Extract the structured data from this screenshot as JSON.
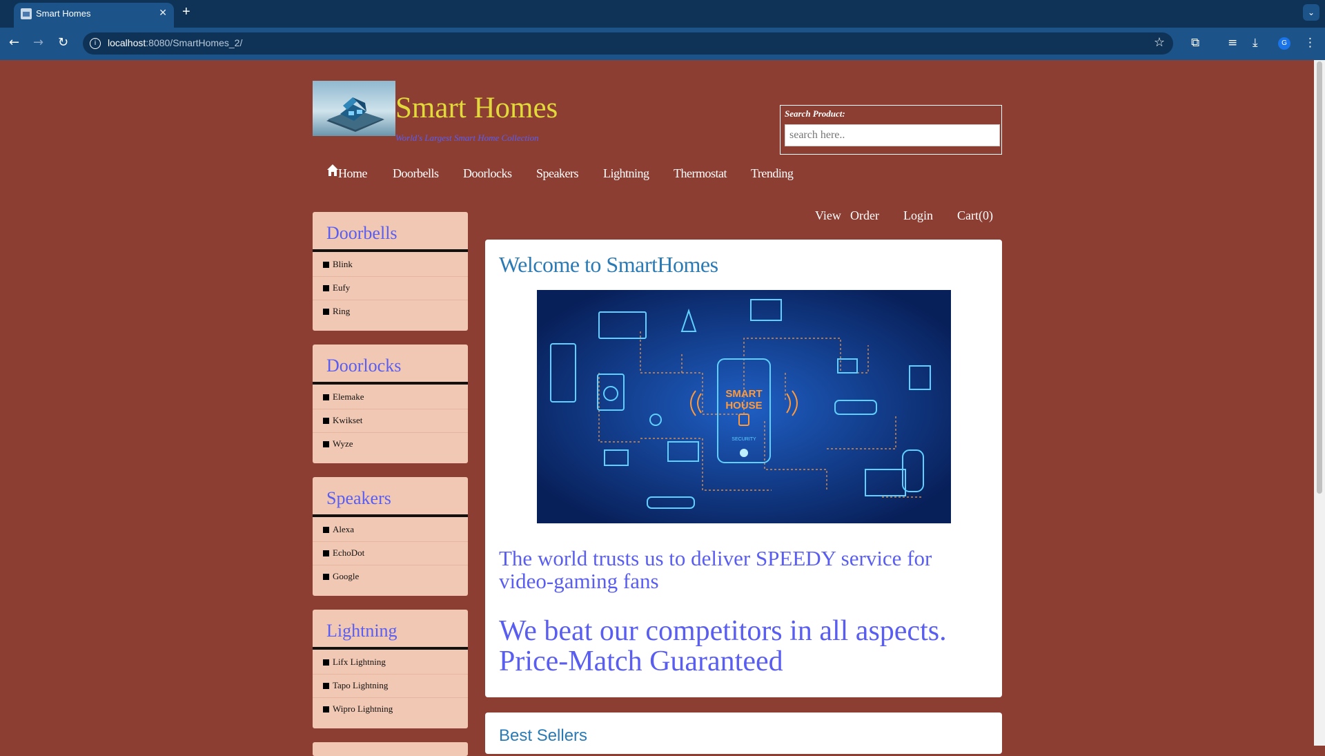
{
  "browser": {
    "tab_title": "Smart Homes",
    "url_host": "localhost",
    "url_rest": ":8080/SmartHomes_2/",
    "avatar_letter": "G"
  },
  "header": {
    "title": "Smart Homes",
    "tagline": "World's Largest Smart Home Collection",
    "search_label": "Search Product:",
    "search_placeholder": "search here.."
  },
  "nav": [
    "Home",
    "Doorbells",
    "Doorlocks",
    "Speakers",
    "Lightning",
    "Thermostat",
    "Trending"
  ],
  "user_nav": [
    "View",
    "Order",
    "Login",
    "Cart(0)"
  ],
  "sidebar": [
    {
      "title": "Doorbells",
      "items": [
        "Blink",
        "Eufy",
        "Ring"
      ]
    },
    {
      "title": "Doorlocks",
      "items": [
        "Elemake",
        "Kwikset",
        "Wyze"
      ]
    },
    {
      "title": "Speakers",
      "items": [
        "Alexa",
        "EchoDot",
        "Google"
      ]
    },
    {
      "title": "Lightning",
      "items": [
        "Lifx Lightning",
        "Tapo Lightning",
        "Wipro Lightning"
      ]
    }
  ],
  "main": {
    "heading": "Welcome to SmartHomes",
    "hero_text_1": "SMART",
    "hero_text_2": "HOUSE",
    "hero_text_3": "SECURITY",
    "para1": "The world trusts us to deliver SPEEDY service for video-gaming fans",
    "para2": "We beat our competitors in all aspects. Price-Match Guaranteed",
    "best_sellers": "Best Sellers"
  },
  "colors": {
    "page_bg": "#8c3e33",
    "title_yellow": "#e2d93b",
    "accent_purple": "#5a5ef0",
    "heading_blue": "#2a7ab5",
    "sidebar_bg": "#f1c8b4"
  }
}
